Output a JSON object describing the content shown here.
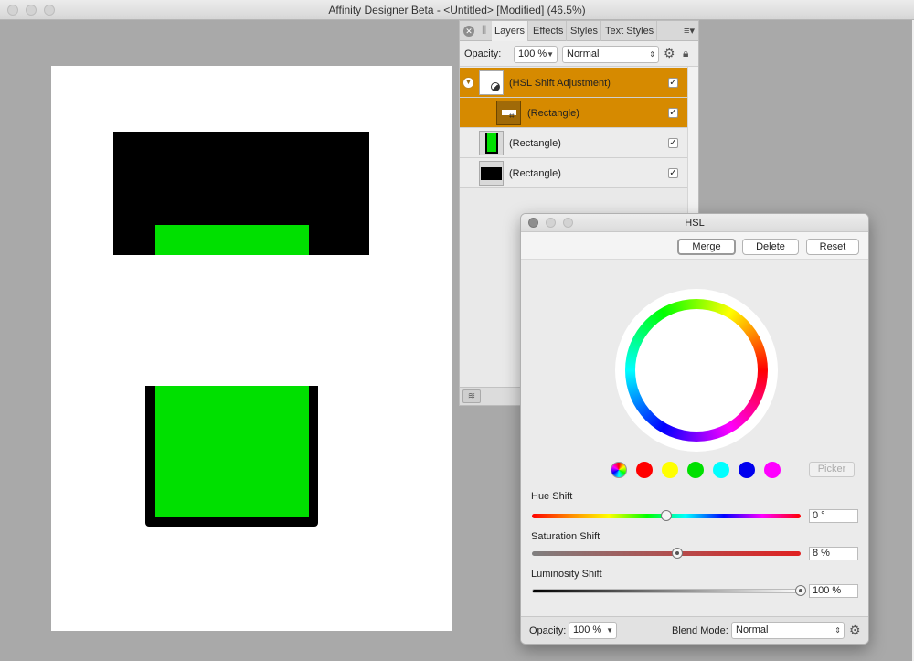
{
  "window": {
    "title": "Affinity Designer Beta - <Untitled> [Modified] (46.5%)"
  },
  "layers_panel": {
    "tabs": [
      "Layers",
      "Effects",
      "Styles",
      "Text Styles"
    ],
    "opacity_label": "Opacity:",
    "opacity_value": "100 %",
    "blend_mode": "Normal",
    "layers": [
      {
        "name": "(HSL Shift Adjustment)",
        "checked": "✓",
        "selected": true
      },
      {
        "name": "(Rectangle)",
        "checked": "✓",
        "selected": true
      },
      {
        "name": "(Rectangle)",
        "checked": "✓",
        "selected": false
      },
      {
        "name": "(Rectangle)",
        "checked": "✓",
        "selected": false
      }
    ]
  },
  "hsl_dialog": {
    "title": "HSL",
    "buttons": {
      "merge": "Merge",
      "delete": "Delete",
      "reset": "Reset"
    },
    "picker_label": "Picker",
    "swatches": [
      "#ff0000",
      "#ffff00",
      "#00e000",
      "#00ffff",
      "#0000ee",
      "#ff00ff"
    ],
    "hue": {
      "label": "Hue Shift",
      "value": "0 °",
      "level": 0.5
    },
    "saturation": {
      "label": "Saturation Shift",
      "value": "8 %",
      "level": 0.54
    },
    "luminosity": {
      "label": "Luminosity Shift",
      "value": "100 %",
      "level": 1.0
    },
    "footer": {
      "opacity_label": "Opacity:",
      "opacity_value": "100 %",
      "blend_label": "Blend Mode:",
      "blend_value": "Normal"
    }
  },
  "colors": {
    "selection": "#d68a00",
    "shape_green": "#00e000",
    "shape_black": "#000000"
  }
}
